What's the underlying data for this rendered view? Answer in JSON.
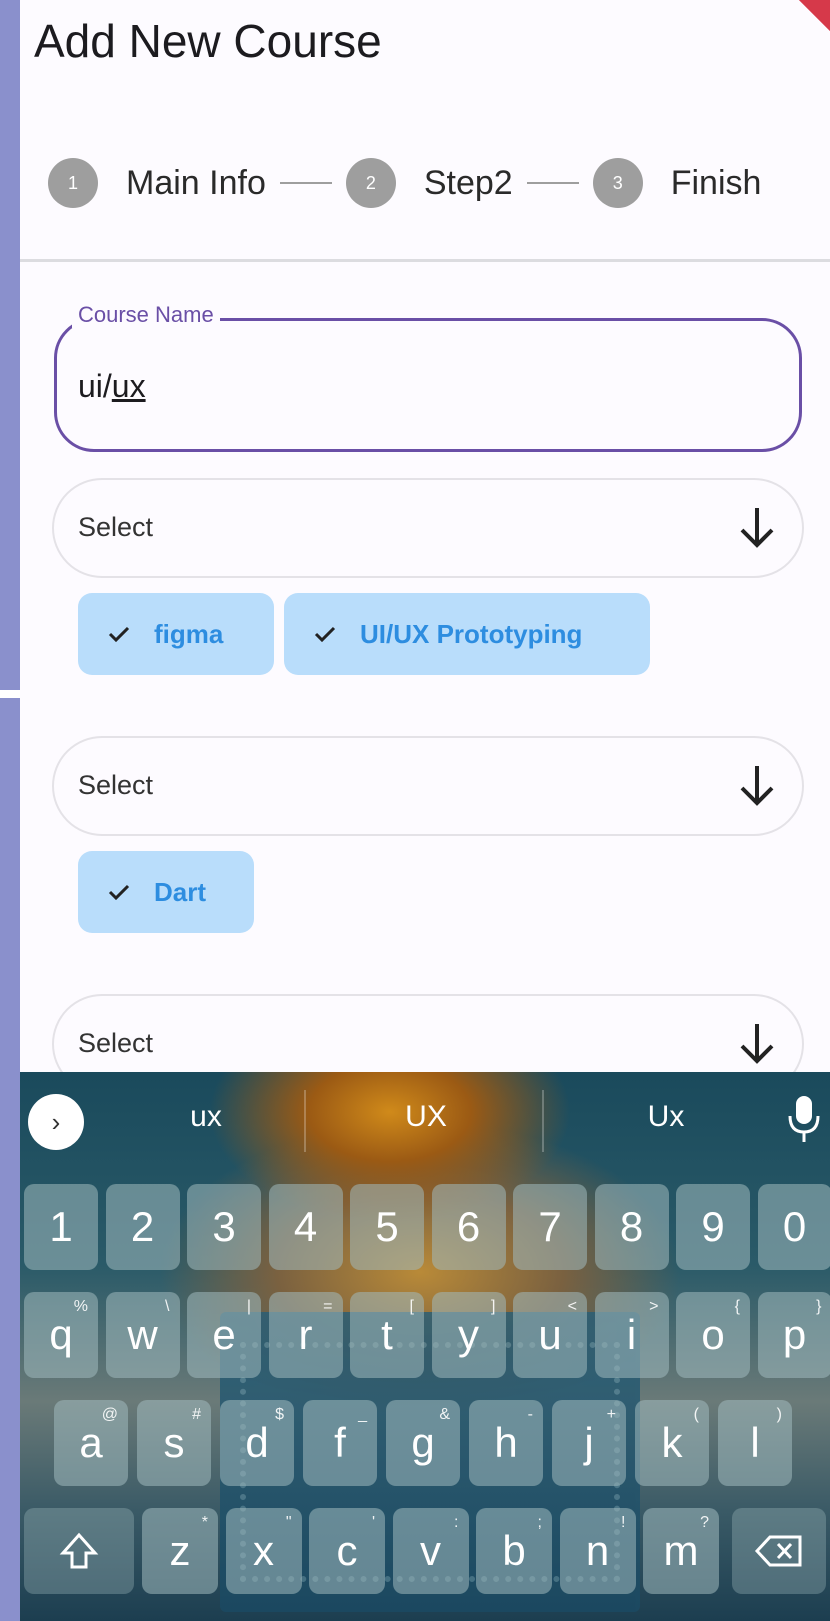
{
  "app_bar": {
    "title": "Add New Course"
  },
  "stepper": {
    "steps": [
      {
        "number": "1",
        "label": "Main Info"
      },
      {
        "number": "2",
        "label": "Step2"
      },
      {
        "number": "3",
        "label": "Finish"
      }
    ]
  },
  "course_name": {
    "label": "Course Name",
    "value_prefix": "ui/",
    "value_underlined": "ux"
  },
  "selects": [
    {
      "label": "Select",
      "chips": [
        "figma",
        "UI/UX Prototyping"
      ]
    },
    {
      "label": "Select",
      "chips": [
        "Dart"
      ]
    },
    {
      "label": "Select",
      "chips": []
    }
  ],
  "keyboard": {
    "expand_glyph": "›",
    "suggestions": [
      "ux",
      "UX",
      "Ux"
    ],
    "rows": {
      "numbers": [
        "1",
        "2",
        "3",
        "4",
        "5",
        "6",
        "7",
        "8",
        "9",
        "0"
      ],
      "top": [
        {
          "k": "q",
          "h": "%"
        },
        {
          "k": "w",
          "h": "\\"
        },
        {
          "k": "e",
          "h": "|"
        },
        {
          "k": "r",
          "h": "="
        },
        {
          "k": "t",
          "h": "["
        },
        {
          "k": "y",
          "h": "]"
        },
        {
          "k": "u",
          "h": "<"
        },
        {
          "k": "i",
          "h": ">"
        },
        {
          "k": "o",
          "h": "{"
        },
        {
          "k": "p",
          "h": "}"
        }
      ],
      "middle": [
        {
          "k": "a",
          "h": "@"
        },
        {
          "k": "s",
          "h": "#"
        },
        {
          "k": "d",
          "h": "$"
        },
        {
          "k": "f",
          "h": "_"
        },
        {
          "k": "g",
          "h": "&"
        },
        {
          "k": "h",
          "h": "-"
        },
        {
          "k": "j",
          "h": "+"
        },
        {
          "k": "k",
          "h": "("
        },
        {
          "k": "l",
          "h": ")"
        }
      ],
      "bottom": [
        {
          "k": "z",
          "h": "*"
        },
        {
          "k": "x",
          "h": "\""
        },
        {
          "k": "c",
          "h": "'"
        },
        {
          "k": "v",
          "h": ":"
        },
        {
          "k": "b",
          "h": ";"
        },
        {
          "k": "n",
          "h": "!"
        },
        {
          "k": "m",
          "h": "?"
        }
      ]
    }
  }
}
